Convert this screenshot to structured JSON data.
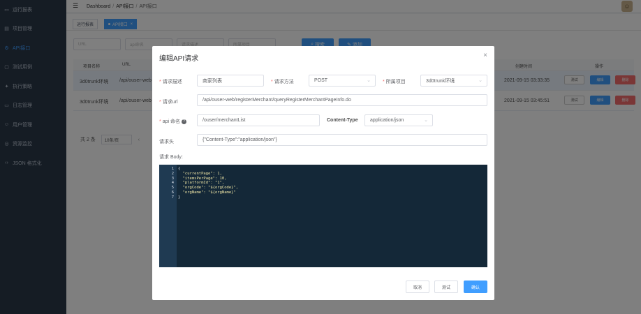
{
  "sidebar": {
    "items": [
      {
        "icon": "monitor-icon",
        "label": "运行报表"
      },
      {
        "icon": "project-icon",
        "label": "项目管理"
      },
      {
        "icon": "api-icon",
        "label": "API接口"
      },
      {
        "icon": "testcase-icon",
        "label": "测试用例"
      },
      {
        "icon": "strategy-icon",
        "label": "执行策略"
      },
      {
        "icon": "log-icon",
        "label": "日志管理"
      },
      {
        "icon": "user-icon",
        "label": "用户管理"
      },
      {
        "icon": "resource-icon",
        "label": "资源监控"
      },
      {
        "icon": "json-icon",
        "label": "JSON 格式化"
      }
    ]
  },
  "header": {
    "breadcrumb": [
      "Dashboard",
      "API接口",
      "API接口"
    ]
  },
  "tags": [
    {
      "label": "运行报表"
    },
    {
      "label": "API接口",
      "close": "×"
    }
  ],
  "filters": {
    "url_placeholder": "URL",
    "api_placeholder": "api命名",
    "desc_placeholder": "请求描述",
    "project_placeholder": "所属项目",
    "search_label": "搜索",
    "add_label": "添加"
  },
  "table": {
    "headers": [
      "项目名称",
      "URL",
      "创建时间",
      "操作"
    ],
    "rows": [
      {
        "project": "3d0trunk环境",
        "url": "/api/ouser-web",
        "created": "2021-09-15 03:33:35"
      },
      {
        "project": "3d0trunk环境",
        "url": "/api/ouser-web",
        "created": "2021-09-15 03:45:51"
      }
    ],
    "actions": {
      "test": "测试",
      "edit": "编辑",
      "delete": "删除"
    }
  },
  "pager": {
    "total": "共 2 条",
    "size": "10条/页",
    "prev": "‹"
  },
  "dialog": {
    "title": "编辑API请求",
    "close": "×",
    "desc_label": "请求描述",
    "desc_value": "商家列表",
    "method_label": "请求方法",
    "method_value": "POST",
    "project_label": "所属项目",
    "project_value": "3d0trunk环境",
    "url_label": "请求url",
    "url_value": "/api/ouser-web/registerMerchant/queryRegisterMerchantPageInfo.do",
    "api_label": "api 命名",
    "api_value": "/ouser/merchantList",
    "ctype_label": "Content-Type",
    "ctype_value": "application/json",
    "header_label": "请求头",
    "header_value": "{\"Content-Type\":\"application/json\"}",
    "body_label": "请求 Body:",
    "body_lines": [
      "{",
      "  \"currentPage\": 1,",
      "  \"itemsPerPage\": 10,",
      "  \"platformId\": \"1\",",
      "  \"orgCode\": \"${orgCode}\",",
      "  \"orgName\": \"${orgName}\"",
      "}"
    ],
    "line_numbers": [
      "1",
      "2",
      "3",
      "4",
      "5",
      "6",
      "7"
    ],
    "cancel_label": "取消",
    "test_label": "测试",
    "confirm_label": "确认"
  },
  "colors": {
    "sidebar_bg": "#2b3849",
    "primary": "#409eff",
    "danger": "#f56c6c",
    "editor_bg": "#142838"
  }
}
